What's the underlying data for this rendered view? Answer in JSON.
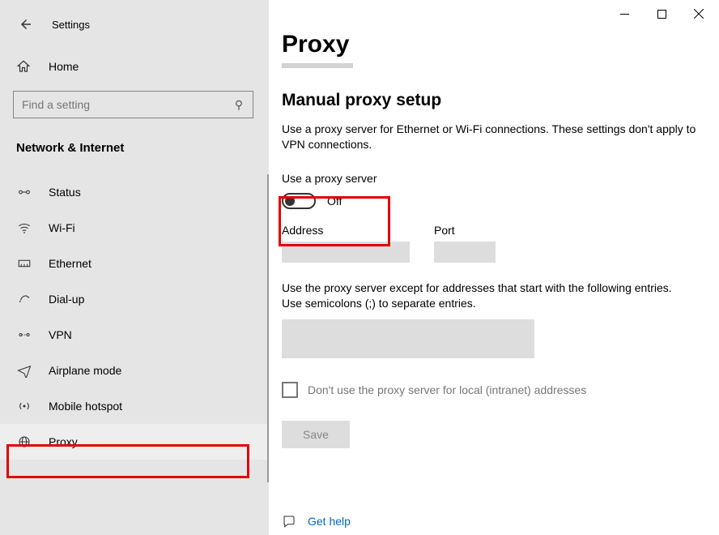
{
  "app_title": "Settings",
  "home_label": "Home",
  "search_placeholder": "Find a setting",
  "section_title": "Network & Internet",
  "nav": [
    {
      "id": "status",
      "label": "Status",
      "icon": "status"
    },
    {
      "id": "wifi",
      "label": "Wi-Fi",
      "icon": "wifi"
    },
    {
      "id": "ethernet",
      "label": "Ethernet",
      "icon": "ethernet"
    },
    {
      "id": "dialup",
      "label": "Dial-up",
      "icon": "dialup"
    },
    {
      "id": "vpn",
      "label": "VPN",
      "icon": "vpn"
    },
    {
      "id": "airplane",
      "label": "Airplane mode",
      "icon": "airplane"
    },
    {
      "id": "hotspot",
      "label": "Mobile hotspot",
      "icon": "hotspot"
    },
    {
      "id": "proxy",
      "label": "Proxy",
      "icon": "proxy"
    }
  ],
  "content": {
    "page_title": "Proxy",
    "section_heading": "Manual proxy setup",
    "description": "Use a proxy server for Ethernet or Wi-Fi connections. These settings don't apply to VPN connections.",
    "toggle_label": "Use a proxy server",
    "toggle_state": "Off",
    "address_label": "Address",
    "address_value": "",
    "port_label": "Port",
    "port_value": "",
    "exceptions_label": "Use the proxy server except for addresses that start with the following entries. Use semicolons (;) to separate entries.",
    "exceptions_value": "",
    "local_checkbox_label": "Don't use the proxy server for local (intranet) addresses",
    "save_label": "Save",
    "help_label": "Get help"
  }
}
